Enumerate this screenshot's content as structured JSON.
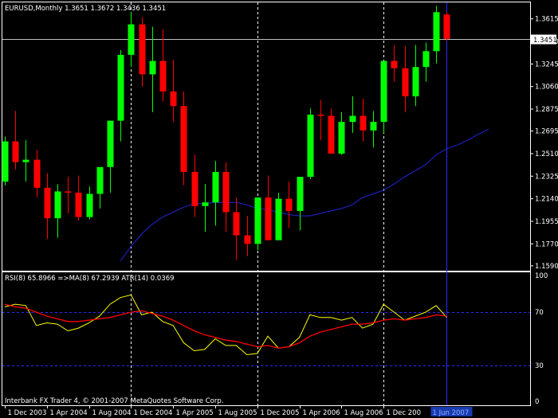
{
  "colors": {
    "background": "#000000",
    "frame": "#ffffff",
    "bull": "#00ff00",
    "bear": "#ff0000",
    "ma_line": "#2222dd",
    "rsi_line": "#ffff00",
    "rsi_ma_line": "#ff0000",
    "level_line": "#2a2aff",
    "cursor_line": "#2a2aff"
  },
  "chart_data": [
    {
      "type": "candlestick",
      "title": "EURUSD,Monthly  1.3651 1.3672 1.3436 1.3451",
      "current_price_label": "1.3451",
      "current_price": 1.3451,
      "ylim": [
        1.155,
        1.375
      ],
      "y_ticks": [
        1.3615,
        1.343,
        1.3245,
        1.306,
        1.2875,
        1.2695,
        1.251,
        1.2325,
        1.214,
        1.1955,
        1.177,
        1.159
      ],
      "y_tick_labels": [
        "1.3615",
        "1.3430",
        "1.3245",
        "1.3060",
        "1.2875",
        "1.2695",
        "1.2510",
        "1.2325",
        "1.2140",
        "1.1955",
        "1.1770",
        "1.1590"
      ],
      "candles": [
        {
          "o": 1.228,
          "h": 1.265,
          "l": 1.225,
          "c": 1.261
        },
        {
          "o": 1.261,
          "h": 1.286,
          "l": 1.238,
          "c": 1.244
        },
        {
          "o": 1.244,
          "h": 1.262,
          "l": 1.228,
          "c": 1.246
        },
        {
          "o": 1.246,
          "h": 1.254,
          "l": 1.215,
          "c": 1.223
        },
        {
          "o": 1.223,
          "h": 1.235,
          "l": 1.181,
          "c": 1.198
        },
        {
          "o": 1.198,
          "h": 1.226,
          "l": 1.182,
          "c": 1.22
        },
        {
          "o": 1.22,
          "h": 1.232,
          "l": 1.202,
          "c": 1.219
        },
        {
          "o": 1.219,
          "h": 1.233,
          "l": 1.196,
          "c": 1.199
        },
        {
          "o": 1.199,
          "h": 1.224,
          "l": 1.197,
          "c": 1.218
        },
        {
          "o": 1.218,
          "h": 1.239,
          "l": 1.206,
          "c": 1.24
        },
        {
          "o": 1.24,
          "h": 1.275,
          "l": 1.219,
          "c": 1.278
        },
        {
          "o": 1.278,
          "h": 1.336,
          "l": 1.261,
          "c": 1.332
        },
        {
          "o": 1.332,
          "h": 1.367,
          "l": 1.322,
          "c": 1.357
        },
        {
          "o": 1.357,
          "h": 1.363,
          "l": 1.306,
          "c": 1.316
        },
        {
          "o": 1.316,
          "h": 1.355,
          "l": 1.285,
          "c": 1.327
        },
        {
          "o": 1.327,
          "h": 1.353,
          "l": 1.294,
          "c": 1.302
        },
        {
          "o": 1.302,
          "h": 1.328,
          "l": 1.277,
          "c": 1.29
        },
        {
          "o": 1.29,
          "h": 1.302,
          "l": 1.225,
          "c": 1.236
        },
        {
          "o": 1.236,
          "h": 1.25,
          "l": 1.199,
          "c": 1.208
        },
        {
          "o": 1.208,
          "h": 1.226,
          "l": 1.187,
          "c": 1.211
        },
        {
          "o": 1.211,
          "h": 1.245,
          "l": 1.192,
          "c": 1.236
        },
        {
          "o": 1.236,
          "h": 1.244,
          "l": 1.187,
          "c": 1.203
        },
        {
          "o": 1.203,
          "h": 1.215,
          "l": 1.164,
          "c": 1.184
        },
        {
          "o": 1.184,
          "h": 1.2,
          "l": 1.167,
          "c": 1.177
        },
        {
          "o": 1.177,
          "h": 1.215,
          "l": 1.172,
          "c": 1.215
        },
        {
          "o": 1.215,
          "h": 1.233,
          "l": 1.18,
          "c": 1.18
        },
        {
          "o": 1.18,
          "h": 1.219,
          "l": 1.182,
          "c": 1.214
        },
        {
          "o": 1.214,
          "h": 1.228,
          "l": 1.19,
          "c": 1.204
        },
        {
          "o": 1.204,
          "h": 1.228,
          "l": 1.188,
          "c": 1.232
        },
        {
          "o": 1.232,
          "h": 1.288,
          "l": 1.23,
          "c": 1.283
        },
        {
          "o": 1.283,
          "h": 1.295,
          "l": 1.262,
          "c": 1.282
        },
        {
          "o": 1.282,
          "h": 1.288,
          "l": 1.251,
          "c": 1.251
        },
        {
          "o": 1.251,
          "h": 1.285,
          "l": 1.25,
          "c": 1.277
        },
        {
          "o": 1.277,
          "h": 1.298,
          "l": 1.268,
          "c": 1.282
        },
        {
          "o": 1.282,
          "h": 1.296,
          "l": 1.261,
          "c": 1.27
        },
        {
          "o": 1.27,
          "h": 1.286,
          "l": 1.256,
          "c": 1.277
        },
        {
          "o": 1.277,
          "h": 1.309,
          "l": 1.268,
          "c": 1.327
        },
        {
          "o": 1.327,
          "h": 1.34,
          "l": 1.31,
          "c": 1.321
        },
        {
          "o": 1.321,
          "h": 1.339,
          "l": 1.285,
          "c": 1.298
        },
        {
          "o": 1.298,
          "h": 1.34,
          "l": 1.29,
          "c": 1.322
        },
        {
          "o": 1.322,
          "h": 1.342,
          "l": 1.31,
          "c": 1.335
        },
        {
          "o": 1.335,
          "h": 1.372,
          "l": 1.325,
          "c": 1.367
        },
        {
          "o": 1.3651,
          "h": 1.3672,
          "l": 1.3436,
          "c": 1.3451
        }
      ],
      "moving_average": {
        "from_index": 11,
        "values": [
          1.163,
          1.175,
          1.185,
          1.193,
          1.199,
          1.203,
          1.207,
          1.21,
          1.21,
          1.211,
          1.211,
          1.211,
          1.209,
          1.206,
          1.205,
          1.203,
          1.201,
          1.2,
          1.2,
          1.202,
          1.204,
          1.206,
          1.209,
          1.215,
          1.218,
          1.221,
          1.226,
          1.232,
          1.237,
          1.242,
          1.25,
          1.255,
          1.258,
          1.262,
          1.267,
          1.271
        ]
      }
    },
    {
      "type": "line",
      "title": "RSI(8) 65.8966  =>MA(8) 67.2939  ATR(14) 0.0369",
      "ylim": [
        0,
        100
      ],
      "y_ticks": [
        100,
        70,
        30,
        0
      ],
      "y_tick_labels": [
        "100",
        "70",
        "30",
        "0"
      ],
      "levels": [
        70,
        30
      ],
      "series": [
        {
          "values": [
            74,
            76,
            75,
            60,
            62,
            61,
            56,
            58,
            62,
            67,
            76,
            81,
            83,
            68,
            70,
            63,
            60,
            47,
            41,
            42,
            50,
            45,
            45,
            38,
            39,
            52,
            43,
            44,
            51,
            68,
            66,
            66,
            64,
            66,
            58,
            61,
            76,
            70,
            64,
            67,
            70,
            75,
            66
          ]
        },
        {
          "values": [
            76,
            74,
            73,
            70,
            67,
            65,
            63,
            63,
            64,
            65,
            66,
            68,
            70,
            71,
            69,
            67,
            64,
            60,
            56,
            53,
            51,
            49,
            48,
            46,
            44,
            45,
            43,
            44,
            47,
            52,
            55,
            57,
            59,
            61,
            61,
            62,
            64,
            65,
            64,
            65,
            66,
            68,
            67
          ]
        }
      ]
    }
  ],
  "x_axis": {
    "tick_labels": [
      "1 Dec 2003",
      "1 Apr 2004",
      "1 Aug 2004",
      "1 Dec 2004",
      "1 Apr 2005",
      "1 Aug 2005",
      "1 Dec 2005",
      "1 Apr 2006",
      "1 Aug 2006",
      "1 Dec 200"
    ],
    "tick_candles": [
      0,
      4,
      8,
      12,
      16,
      20,
      24,
      28,
      32,
      36
    ],
    "year_marker_candles": [
      12,
      24,
      36
    ],
    "cursor_label": "1 Jun 2007",
    "cursor_candle": 42
  },
  "copyright": "Interbank FX Trader 4, © 2001-2007 MetaQuotes Software Corp."
}
